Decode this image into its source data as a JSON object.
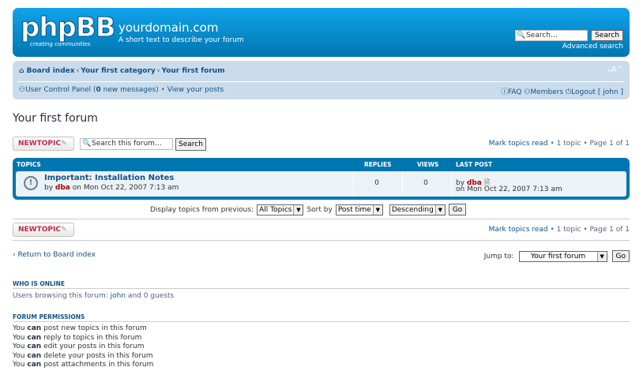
{
  "header": {
    "logo_text": "phpBB",
    "logo_tagline": "creating communities",
    "site_title": "yourdomain.com",
    "site_description": "A short text to describe your forum",
    "search_placeholder": "Search…",
    "search_button": "Search",
    "advanced_search": "Advanced search"
  },
  "navbar": {
    "breadcrumb": [
      "Board index",
      "Your first category",
      "Your first forum"
    ],
    "font_size_control": "ᵥA^",
    "ucp_prefix": "User Control Panel (",
    "ucp_count": "0",
    "ucp_suffix": " new messages)",
    "view_posts": "View your posts",
    "faq": "FAQ",
    "members": "Members",
    "logout": "Logout [ john ]"
  },
  "forum": {
    "title": "Your first forum",
    "new_topic_label": "NEWTOPIC",
    "search_placeholder": "Search this forum…",
    "search_button": "Search",
    "mark_read": "Mark topics read",
    "topic_count": "1 topic",
    "page": "Page 1 of 1"
  },
  "table": {
    "headers": {
      "topics": "TOPICS",
      "replies": "REPLIES",
      "views": "VIEWS",
      "last_post": "LAST POST"
    },
    "rows": [
      {
        "title": "Important: Installation Notes",
        "by_prefix": "by",
        "author": "dba",
        "date": "on Mon Oct 22, 2007 7:13 am",
        "replies": "0",
        "views": "0",
        "last_by": "by",
        "last_author": "dba",
        "last_date": "on Mon Oct 22, 2007 7:13 am"
      }
    ]
  },
  "display": {
    "label": "Display topics from previous:",
    "period": "All Topics",
    "sort_label": "Sort by",
    "sort_key": "Post time",
    "order": "Descending",
    "go": "Go"
  },
  "footer_nav": {
    "return": "Return to Board index",
    "jump_label": "Jump to:",
    "jump_value": "Your first forum",
    "go": "Go"
  },
  "who_is_online": {
    "title": "WHO IS ONLINE",
    "text_prefix": "Users browsing this forum: ",
    "user": "john",
    "text_suffix": " and 0 guests"
  },
  "permissions": {
    "title": "FORUM PERMISSIONS",
    "lines": [
      {
        "pre": "You ",
        "can": "can",
        "post": " post new topics in this forum"
      },
      {
        "pre": "You ",
        "can": "can",
        "post": " reply to topics in this forum"
      },
      {
        "pre": "You ",
        "can": "can",
        "post": " edit your posts in this forum"
      },
      {
        "pre": "You ",
        "can": "can",
        "post": " delete your posts in this forum"
      },
      {
        "pre": "You ",
        "can": "can",
        "post": " post attachments in this forum"
      }
    ]
  },
  "colors": {
    "header_blue": "#0076b1",
    "nav_bg": "#cadceb",
    "link": "#105289",
    "author": "#aa0000",
    "new_topic": "#bc2a4d"
  }
}
